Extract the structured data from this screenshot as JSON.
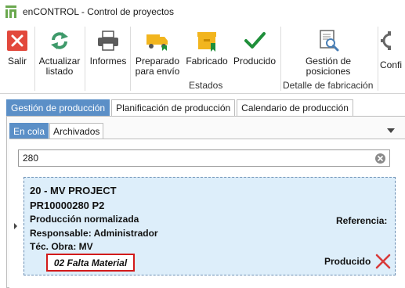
{
  "window": {
    "title": "enCONTROL - Control de proyectos"
  },
  "ribbon": {
    "buttons": {
      "salir": "Salir",
      "actualizar_line1": "Actualizar",
      "actualizar_line2": "listado",
      "informes": "Informes",
      "preparado_line1": "Preparado",
      "preparado_line2": "para envío",
      "fabricado": "Fabricado",
      "producido": "Producido",
      "gestion_line1": "Gestión de",
      "gestion_line2": "posiciones",
      "config": "Confi"
    },
    "groups": {
      "estados": "Estados",
      "detalle": "Detalle de fabricación"
    }
  },
  "main_tabs": [
    "Gestión de producción",
    "Planificación de producción",
    "Calendario de producción"
  ],
  "sub_tabs": [
    "En cola",
    "Archivados"
  ],
  "search": {
    "value": "280"
  },
  "card": {
    "title": "20 - MV PROJECT",
    "code": "PR10000280 P2",
    "type": "Producción normalizada",
    "responsable": "Responsable: Administrador",
    "tec_obra": "Téc. Obra: MV",
    "referencia_label": "Referencia:",
    "status": "02 Falta Material",
    "state_label": "Producido"
  },
  "colors": {
    "accent_tab": "#5b8fc7",
    "card_bg": "#ddeefa",
    "status_border": "#d21a1a",
    "check_green": "#1f8f3a",
    "exit_red": "#e2483c",
    "refresh_green": "#3f9a6b"
  }
}
